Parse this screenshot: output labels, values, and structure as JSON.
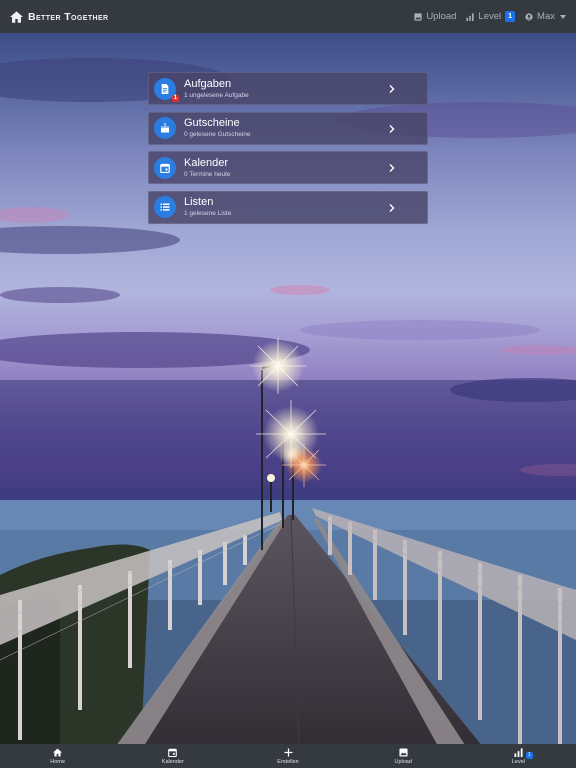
{
  "app": {
    "brand": "Better Together"
  },
  "nav": {
    "upload_label": "Upload",
    "level_label": "Level",
    "level_value": "1",
    "user_label": "Max"
  },
  "cards": [
    {
      "title": "Aufgaben",
      "subtitle": "1 ungelesene Aufgabe",
      "badge": "1",
      "icon": "document-icon"
    },
    {
      "title": "Gutscheine",
      "subtitle": "0 gelesene Gutscheine",
      "icon": "cake-icon"
    },
    {
      "title": "Kalender",
      "subtitle": "0 Termine heute",
      "icon": "calendar-icon"
    },
    {
      "title": "Listen",
      "subtitle": "1 gelesene Liste",
      "icon": "list-icon"
    }
  ],
  "tabs": [
    {
      "label": "Home",
      "icon": "home-icon"
    },
    {
      "label": "Kalender",
      "icon": "calendar-icon"
    },
    {
      "label": "Erstellen",
      "icon": "plus-icon"
    },
    {
      "label": "Upload",
      "icon": "image-icon"
    },
    {
      "label": "Level",
      "icon": "bar-chart-icon",
      "badge": "1"
    }
  ],
  "colors": {
    "navbar": "#343a40",
    "accent": "#2a7de1",
    "badge_red": "#e03131",
    "badge_blue": "#1a73e8"
  }
}
